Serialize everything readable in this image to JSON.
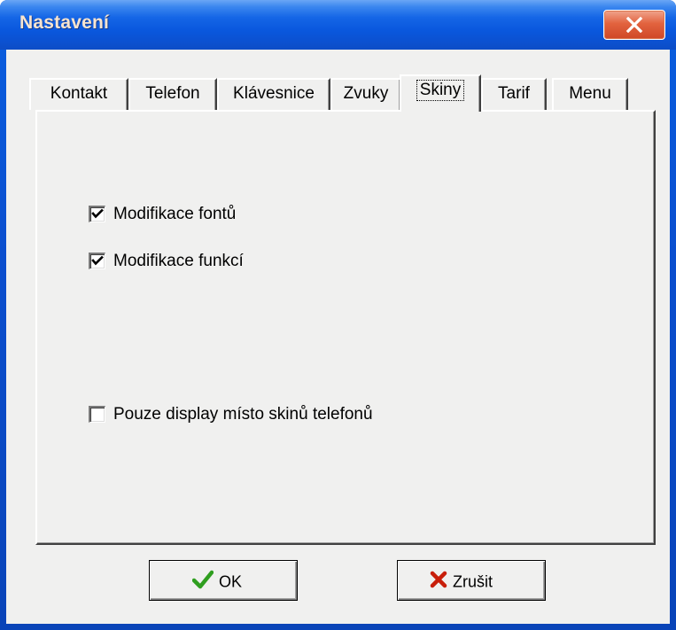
{
  "window": {
    "title": "Nastavení"
  },
  "tabs": [
    {
      "label": "Kontakt",
      "selected": false
    },
    {
      "label": "Telefon",
      "selected": false
    },
    {
      "label": "Klávesnice",
      "selected": false
    },
    {
      "label": "Zvuky",
      "selected": false
    },
    {
      "label": "Skiny",
      "selected": true
    },
    {
      "label": "Tarif",
      "selected": false
    },
    {
      "label": "Menu",
      "selected": false
    }
  ],
  "skiny": {
    "options": [
      {
        "label": "Modifikace fontů",
        "checked": true
      },
      {
        "label": "Modifikace funkcí",
        "checked": true
      },
      {
        "label": "Pouze display místo skinů telefonů",
        "checked": false
      }
    ]
  },
  "buttons": {
    "ok_label": "OK",
    "cancel_label": "Zrušit"
  },
  "colors": {
    "titlebar": "#0b52d3",
    "title_text": "#f7e4cf",
    "close_button": "#e2633f",
    "dialog_face": "#f0f0ef",
    "ok_check": "#2f9e1f",
    "cancel_x": "#c81e0a"
  },
  "icons": {
    "close": "close-x-icon",
    "ok": "green-checkmark-icon",
    "cancel": "red-x-icon"
  }
}
